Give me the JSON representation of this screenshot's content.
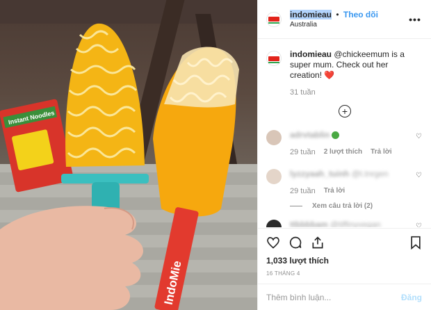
{
  "post": {
    "account": {
      "handle": "indomieau",
      "follow_label": "Theo dõi",
      "separator": "•",
      "location": "Australia"
    },
    "caption": {
      "handle": "indomieau",
      "text": "@chickeemum is a super mum. Check out her creation!",
      "emoji": "❤️",
      "time": "31 tuần"
    },
    "comments": [
      {
        "user": "adrvtablin",
        "text": "",
        "time": "29 tuần",
        "likes_label": "2 lượt thích",
        "reply_label": "Trả lời"
      },
      {
        "user": "lyzzyaah_tuinh",
        "text": "@t.tnrgen",
        "time": "29 tuần",
        "likes_label": "",
        "reply_label": "Trả lời",
        "view_replies": "Xem câu trả lời (2)"
      },
      {
        "user": "ttbbbbam",
        "text": "@tiffinyvegan",
        "time": "",
        "likes_label": "",
        "reply_label": ""
      }
    ],
    "likes": "1,033 lượt thích",
    "date": "16 THÁNG 4",
    "add_comment_placeholder": "Thêm bình luận...",
    "post_label": "Đăng"
  },
  "photo": {
    "left_popsicle_color": "#f4b515",
    "right_popsicle_color": "#f6a80e",
    "stick_left_color": "#3bbfbf",
    "stick_right_color": "#e23a2e",
    "brand_text": "IndoMie",
    "packet_text": "Instant Noodles"
  }
}
